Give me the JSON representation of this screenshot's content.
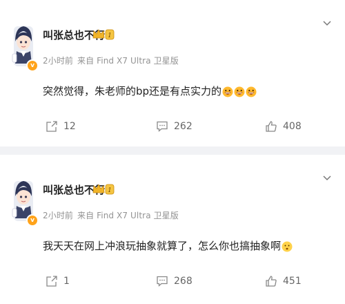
{
  "posts": [
    {
      "username": "叫张总也不行",
      "badge_level": "1",
      "time": "2小时前",
      "source": "来自 Find X7 Ultra 卫星版",
      "text": "突然觉得，朱老师的bp还是有点实力的",
      "emojis": [
        "grin-emoji",
        "grin-emoji",
        "grin-emoji"
      ],
      "shares": "12",
      "comments": "262",
      "likes": "408"
    },
    {
      "username": "叫张总也不行",
      "badge_level": "1",
      "time": "2小时前",
      "source": "来自 Find X7 Ultra 卫星版",
      "text": "我天天在网上冲浪玩抽象就算了，怎么你也搞抽象啊",
      "emojis": [
        "surprised-emoji"
      ],
      "shares": "1",
      "comments": "268",
      "likes": "451"
    }
  ],
  "colors": {
    "background": "#f1f2f5",
    "card": "#ffffff",
    "meta_text": "#939393",
    "badge_orange": "#ffa31a"
  }
}
